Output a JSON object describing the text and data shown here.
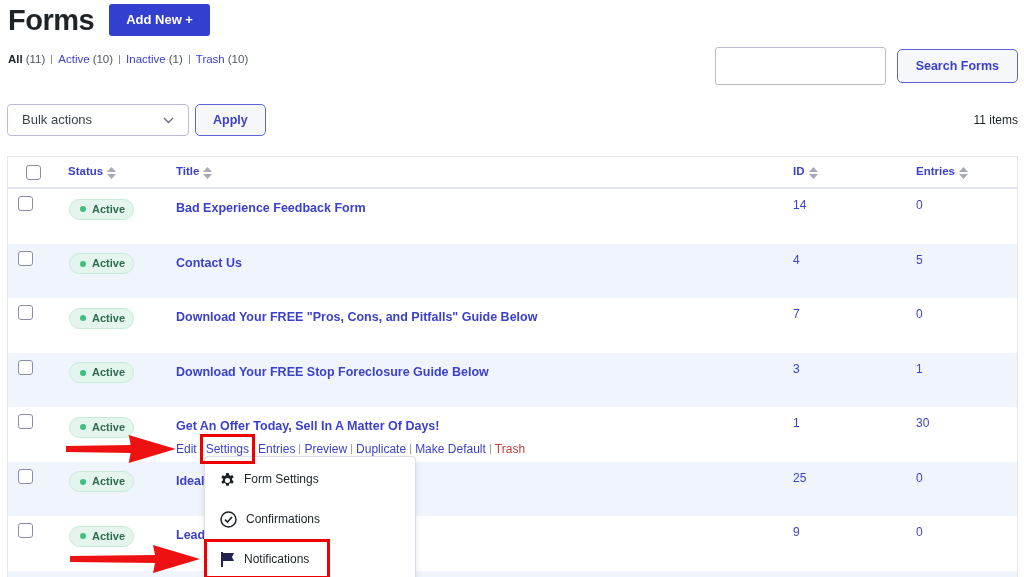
{
  "header": {
    "title": "Forms",
    "add_button": "Add New +"
  },
  "filters": [
    {
      "label": "All",
      "count": "(11)",
      "selected": true
    },
    {
      "label": "Active",
      "count": "(10)",
      "selected": false
    },
    {
      "label": "Inactive",
      "count": "(1)",
      "selected": false
    },
    {
      "label": "Trash",
      "count": "(10)",
      "selected": false
    }
  ],
  "search": {
    "button": "Search Forms"
  },
  "bulk": {
    "value": "Bulk actions",
    "apply": "Apply"
  },
  "items_count": "11 items",
  "table": {
    "header_checked": false,
    "columns": [
      "Status",
      "Title",
      "ID",
      "Entries"
    ],
    "rows": [
      {
        "checked": false,
        "status": "Active",
        "title": "Bad Experience Feedback Form",
        "id": "14",
        "entries": "0"
      },
      {
        "checked": false,
        "status": "Active",
        "title": "Contact Us",
        "id": "4",
        "entries": "5"
      },
      {
        "checked": false,
        "status": "Active",
        "title": "Download Your FREE \"Pros, Cons, and Pitfalls\" Guide Below",
        "id": "7",
        "entries": "0"
      },
      {
        "checked": false,
        "status": "Active",
        "title": "Download Your FREE Stop Foreclosure Guide Below",
        "id": "3",
        "entries": "1"
      },
      {
        "checked": false,
        "status": "Active",
        "title": "Get An Offer Today, Sell In A Matter Of Days!",
        "id": "1",
        "entries": "30",
        "actions": [
          {
            "label": "Edit",
            "kind": "link",
            "highlighted": false
          },
          {
            "label": "Settings",
            "kind": "link",
            "highlighted": true
          },
          {
            "label": "Entries",
            "kind": "link",
            "highlighted": false
          },
          {
            "label": "Preview",
            "kind": "link",
            "highlighted": false
          },
          {
            "label": "Duplicate",
            "kind": "link",
            "highlighted": false
          },
          {
            "label": "Make Default",
            "kind": "link",
            "highlighted": false
          },
          {
            "label": "Trash",
            "kind": "danger",
            "highlighted": false
          }
        ]
      },
      {
        "checked": false,
        "status": "Active",
        "title": "Ideal",
        "id": "25",
        "entries": "0"
      },
      {
        "checked": false,
        "status": "Active",
        "title": "Lead",
        "id": "9",
        "entries": "0"
      }
    ]
  },
  "settings_menu": {
    "items": [
      {
        "kind": "gear",
        "label": "Form Settings",
        "highlighted": false
      },
      {
        "kind": "check",
        "label": "Confirmations",
        "highlighted": false
      },
      {
        "kind": "flag",
        "label": "Notifications",
        "highlighted": true
      }
    ]
  }
}
